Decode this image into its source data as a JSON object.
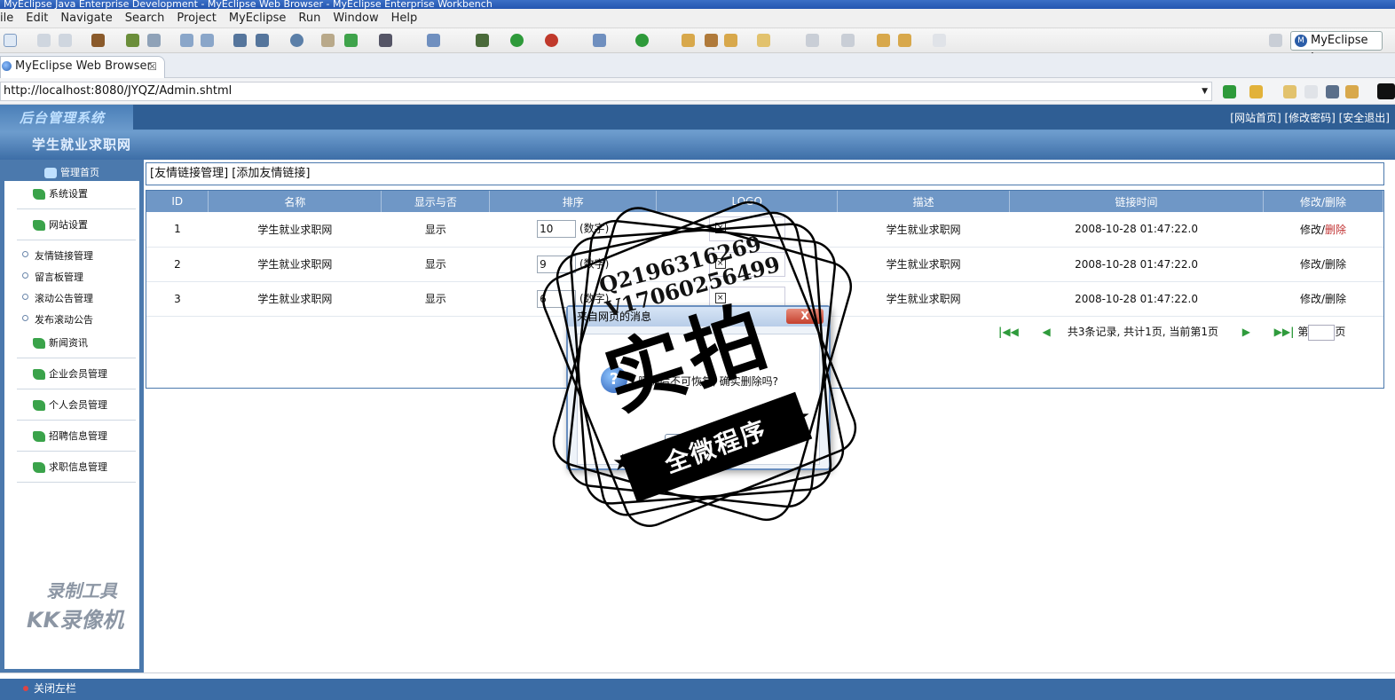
{
  "window": {
    "title": "MyEclipse Java Enterprise Development - MyEclipse Web Browser - MyEclipse Enterprise Workbench"
  },
  "menu": [
    "ile",
    "Edit",
    "Navigate",
    "Search",
    "Project",
    "MyEclipse",
    "Run",
    "Window",
    "Help"
  ],
  "perspective_label": "MyEclipse J...",
  "editor_tab": {
    "label": "MyEclipse Web Browser",
    "close": "☒"
  },
  "address": {
    "url": "http://localhost:8080/JYQZ/Admin.shtml"
  },
  "banner": {
    "logo_title": "后台管理系统",
    "site_title": "学生就业求职网",
    "links": "[网站首页] [修改密码] [安全退出]"
  },
  "sidebar": {
    "home": "管理首页",
    "groups": [
      {
        "label": "系统设置"
      },
      {
        "label": "网站设置"
      }
    ],
    "subitems": [
      "友情链接管理",
      "留言板管理",
      "滚动公告管理",
      "发布滚动公告"
    ],
    "groups2": [
      {
        "label": "新闻资讯"
      },
      {
        "label": "企业会员管理"
      },
      {
        "label": "个人会员管理"
      },
      {
        "label": "招聘信息管理"
      },
      {
        "label": "求职信息管理"
      }
    ]
  },
  "breadcrumb": "[友情链接管理] [添加友情链接]",
  "table": {
    "headers": [
      "ID",
      "名称",
      "显示与否",
      "排序",
      "LOGO",
      "描述",
      "链接时间",
      "修改/删除"
    ],
    "rows": [
      {
        "id": "1",
        "name": "学生就业求职网",
        "show": "显示",
        "order": "10",
        "order_hint": "(数字)",
        "desc": "学生就业求职网",
        "time": "2008-10-28 01:47:22.0",
        "edit": "修改",
        "sep": "/",
        "del": "删除"
      },
      {
        "id": "2",
        "name": "学生就业求职网",
        "show": "显示",
        "order": "9",
        "order_hint": "(数字)",
        "desc": "学生就业求职网",
        "time": "2008-10-28 01:47:22.0",
        "edit": "修改",
        "sep": "/",
        "del": "删除"
      },
      {
        "id": "3",
        "name": "学生就业求职网",
        "show": "显示",
        "order": "6",
        "order_hint": "(数字)",
        "desc": "学生就业求职网",
        "time": "2008-10-28 01:47:22.0",
        "edit": "修改",
        "sep": "/",
        "del": "删除"
      }
    ],
    "del_color": "#c03030"
  },
  "pager": {
    "summary": "共3条记录, 共计1页, 当前第1页",
    "page_prefix": "第",
    "page_suffix": "页"
  },
  "dialog": {
    "title": "来自网页的消息",
    "close": "X",
    "message": "删除后不可恢复, 确实删除吗?"
  },
  "stamp": {
    "qq1": "Q2196316269",
    "qq2": "V17060256499",
    "big": "实拍",
    "ribbon": "全微程序"
  },
  "watermark_tool": {
    "line1": "录制工具",
    "line2": "KK录像机"
  },
  "footer": {
    "close_sidebar": "关闭左栏"
  }
}
